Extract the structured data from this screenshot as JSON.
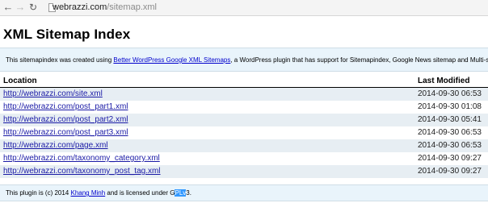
{
  "browser": {
    "url_host": "webrazzi.com",
    "url_path": "/sitemap.xml"
  },
  "page": {
    "title": "XML Sitemap Index"
  },
  "info": {
    "prefix": "This sitemapindex was created using ",
    "link": "Better WordPress Google XML Sitemaps",
    "suffix": ", a WordPress plugin that has support for Sitemapindex, Google News sitemap and Multi-site."
  },
  "table": {
    "headers": {
      "location": "Location",
      "last_modified": "Last Modified"
    },
    "rows": [
      {
        "location": "http://webrazzi.com/site.xml",
        "last_modified": "2014-09-30 06:53"
      },
      {
        "location": "http://webrazzi.com/post_part1.xml",
        "last_modified": "2014-09-30 01:08"
      },
      {
        "location": "http://webrazzi.com/post_part2.xml",
        "last_modified": "2014-09-30 05:41"
      },
      {
        "location": "http://webrazzi.com/post_part3.xml",
        "last_modified": "2014-09-30 06:53"
      },
      {
        "location": "http://webrazzi.com/page.xml",
        "last_modified": "2014-09-30 06:53"
      },
      {
        "location": "http://webrazzi.com/taxonomy_category.xml",
        "last_modified": "2014-09-30 09:27"
      },
      {
        "location": "http://webrazzi.com/taxonomy_post_tag.xml",
        "last_modified": "2014-09-30 09:27"
      }
    ]
  },
  "footer": {
    "prefix": "This plugin is (c) 2014 ",
    "author": "Khang Minh",
    "middle": " and is licensed under ",
    "license_a": "G",
    "license_sel": "PLv",
    "license_b": "3."
  }
}
